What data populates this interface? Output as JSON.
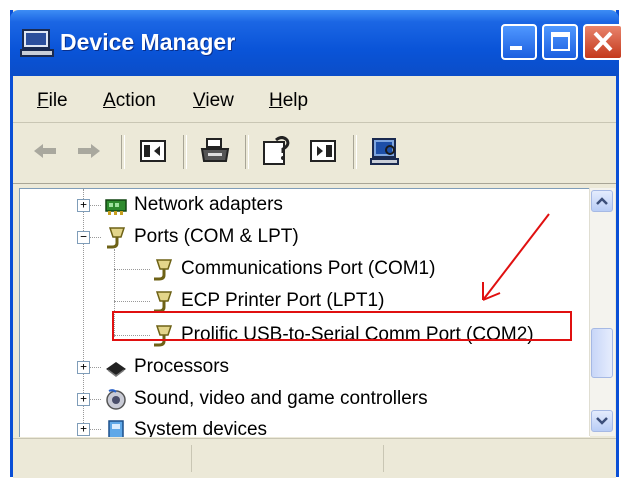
{
  "window": {
    "title": "Device Manager",
    "title_icon": "computer-icon"
  },
  "title_buttons": {
    "minimize": "minimize-icon",
    "maximize": "maximize-icon",
    "close": "close-icon"
  },
  "menu": {
    "items": [
      {
        "label": "File"
      },
      {
        "label": "Action"
      },
      {
        "label": "View"
      },
      {
        "label": "Help"
      }
    ]
  },
  "toolbar": {
    "buttons": [
      "back-arrow-icon",
      "forward-arrow-icon",
      "show-hide-tree-icon",
      "print-icon",
      "properties-help-icon",
      "show-hide-action-pane-icon",
      "scan-hardware-icon"
    ]
  },
  "tree": {
    "items": [
      {
        "label": "Network adapters",
        "icon": "network-adapter-icon",
        "expander": "+"
      },
      {
        "label": "Ports (COM & LPT)",
        "icon": "port-connector-icon",
        "expander": "−"
      },
      {
        "label": "Communications Port (COM1)",
        "icon": "port-connector-icon"
      },
      {
        "label": "ECP Printer Port (LPT1)",
        "icon": "port-connector-icon"
      },
      {
        "label": "Prolific USB-to-Serial Comm Port (COM2)",
        "icon": "port-connector-icon",
        "highlighted": true
      },
      {
        "label": "Processors",
        "icon": "processor-icon",
        "expander": "+"
      },
      {
        "label": "Sound, video and game controllers",
        "icon": "speaker-icon",
        "expander": "+"
      },
      {
        "label": "System devices",
        "icon": "system-device-icon",
        "expander": "+"
      }
    ]
  },
  "annotation": {
    "highlight_color": "#e01010",
    "arrow_color": "#e01010"
  },
  "colors": {
    "titlebar": "#0a54d8",
    "window_bg": "#ece9d8",
    "close_button": "#c4391c"
  }
}
